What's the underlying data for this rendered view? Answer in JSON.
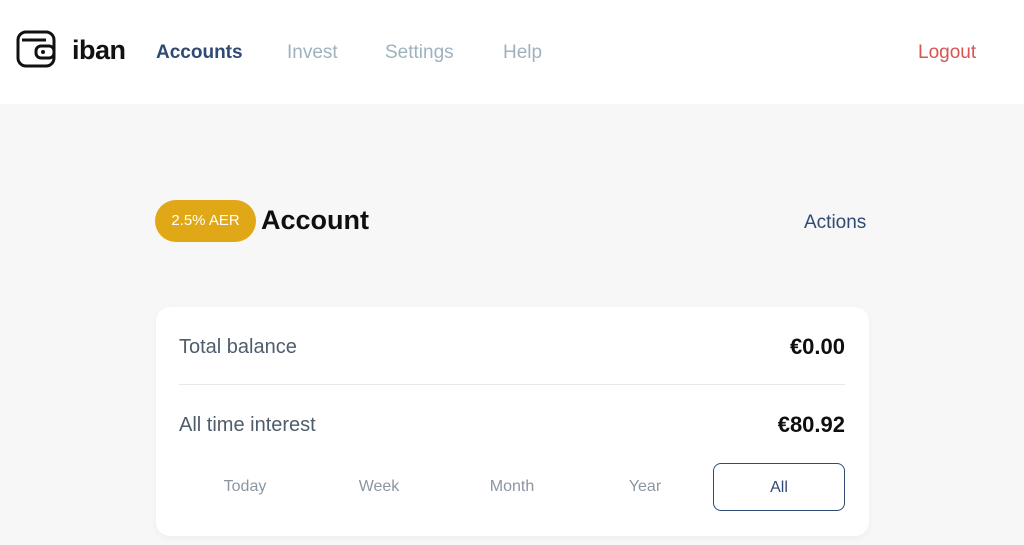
{
  "brand": {
    "name": "iban",
    "logo_icon": "wallet-icon"
  },
  "nav": {
    "items": [
      {
        "label": "Accounts",
        "active": true
      },
      {
        "label": "Invest",
        "active": false
      },
      {
        "label": "Settings",
        "active": false
      },
      {
        "label": "Help",
        "active": false
      }
    ],
    "logout_label": "Logout"
  },
  "account": {
    "badge": "2.5% AER",
    "title": "Account",
    "actions_label": "Actions"
  },
  "summary": {
    "total_balance_label": "Total balance",
    "total_balance_value": "€0.00",
    "interest_label": "All time interest",
    "interest_value": "€80.92",
    "periods": [
      "Today",
      "Week",
      "Month",
      "Year",
      "All"
    ],
    "selected_period": "All"
  },
  "colors": {
    "accent": "#2f4a73",
    "badge": "#e0a816",
    "logout": "#d9534f",
    "nav_inactive": "#9fb2be",
    "background": "#f7f7f7"
  }
}
